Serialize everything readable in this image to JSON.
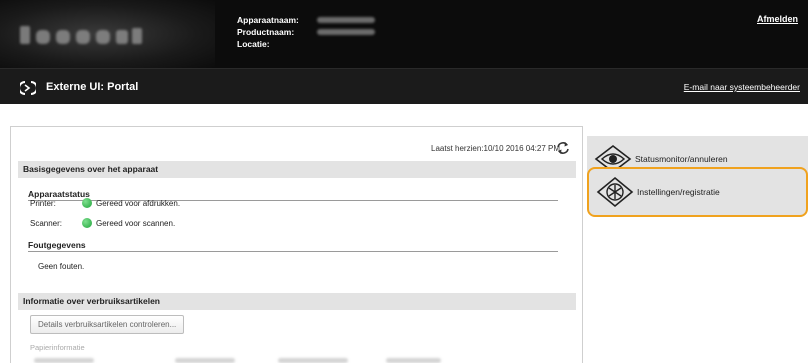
{
  "header": {
    "device_info": [
      {
        "label": "Apparaatnaam:"
      },
      {
        "label": "Productnaam:"
      },
      {
        "label": "Locatie:"
      }
    ],
    "logout_label": "Afmelden",
    "portal_title": "Externe UI: Portal",
    "mail_link": "E-mail naar systeembeheerder"
  },
  "main": {
    "last_updated": "Laatst herzien:10/10 2016 04:27 PM",
    "device_section": {
      "title": "Basisgegevens over het apparaat",
      "status_title": "Apparaatstatus",
      "rows": [
        {
          "key": "Printer:",
          "value": "Gereed voor afdrukken."
        },
        {
          "key": "Scanner:",
          "value": "Gereed voor scannen."
        }
      ],
      "error_title": "Foutgegevens",
      "error_text": "Geen fouten."
    },
    "consumables_section": {
      "title": "Informatie over verbruiksartikelen",
      "button_label": "Details verbruiksartikelen controleren...",
      "paper_label": "Papierinformatie"
    }
  },
  "menu": [
    {
      "label": "Statusmonitor/annuleren",
      "icon": "eye-icon"
    },
    {
      "label": "Instellingen/registratie",
      "icon": "settings-icon"
    }
  ],
  "colors": {
    "header_bg": "#0c0c0c",
    "section_bg": "#e3e3e3",
    "status_green": "#1fa33a",
    "highlight": "#f0a21e"
  }
}
